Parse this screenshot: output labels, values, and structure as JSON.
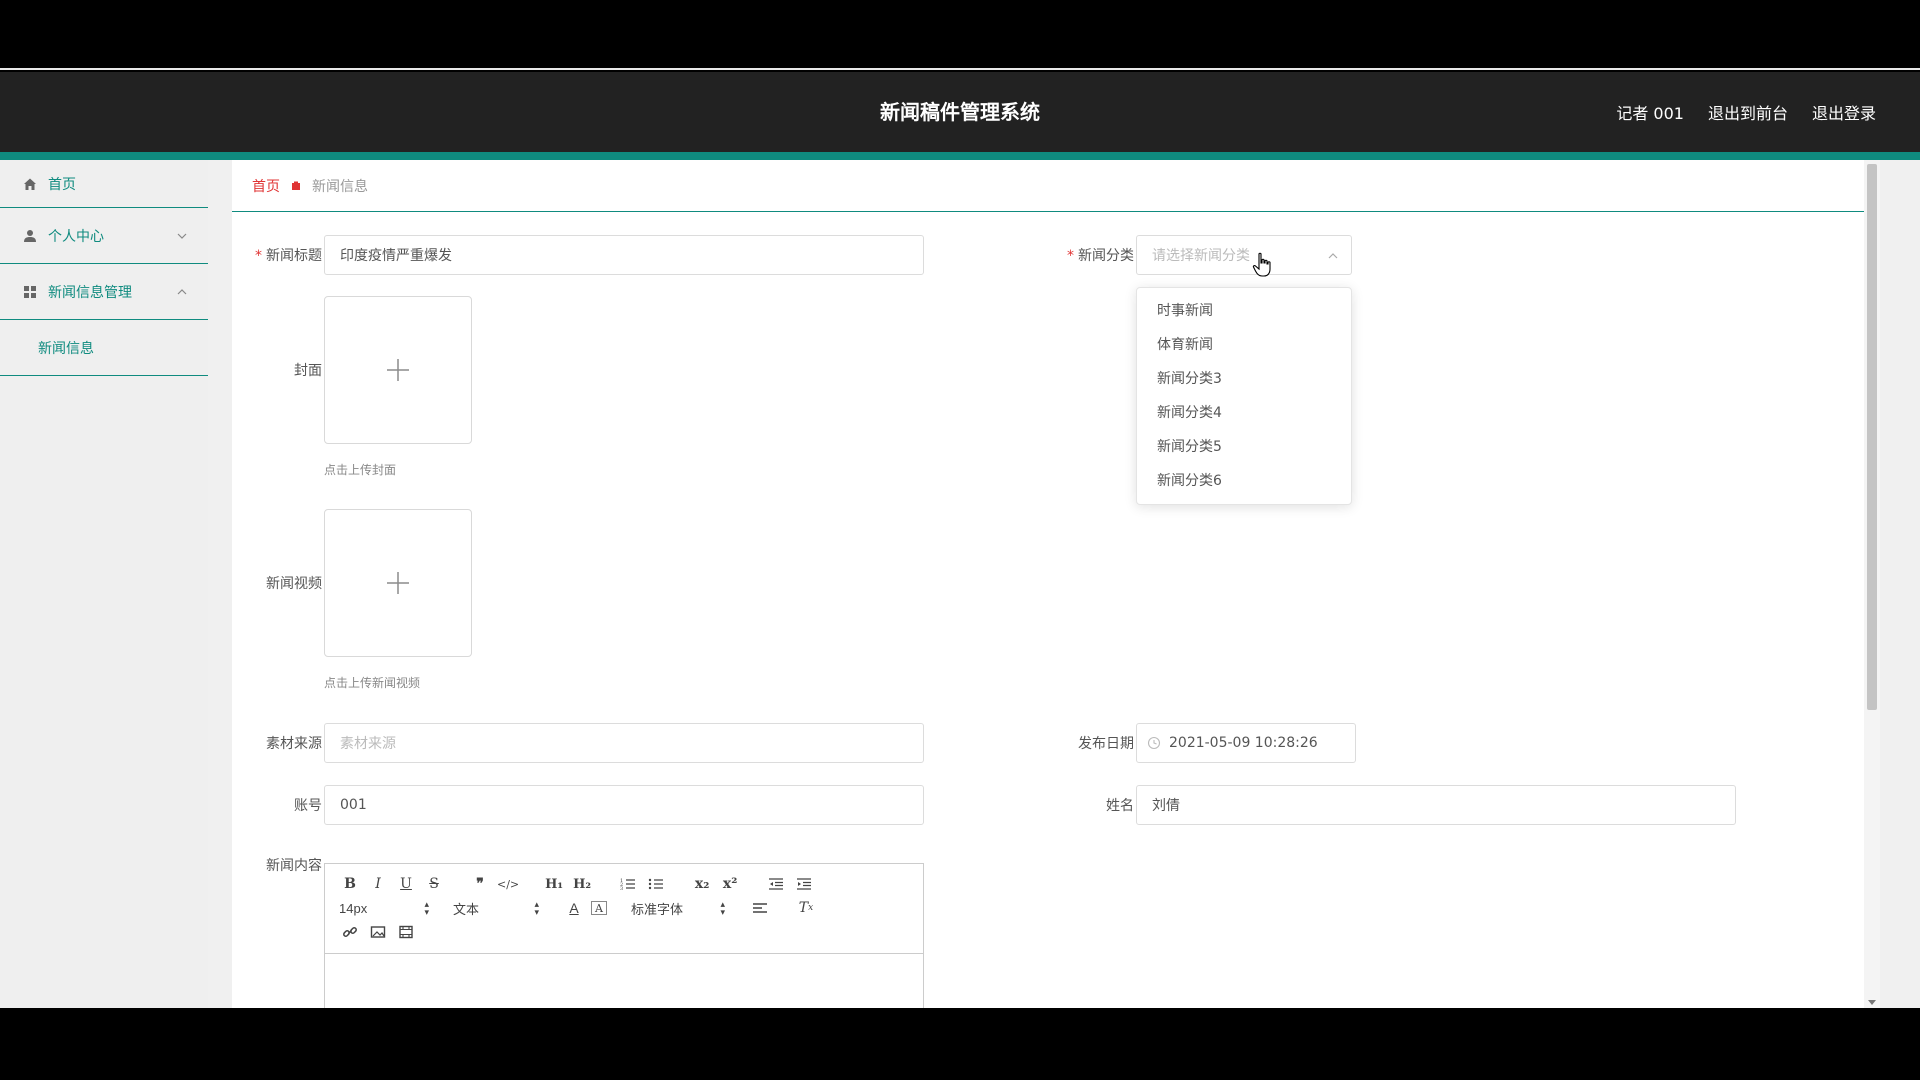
{
  "app": {
    "title": "新闻稿件管理系统",
    "user": "记者 001",
    "exit_front": "退出到前台",
    "logout": "退出登录",
    "accent_color": "#0f8b7f"
  },
  "sidebar": {
    "items": [
      {
        "label": "首页",
        "icon": "home-icon"
      },
      {
        "label": "个人中心",
        "icon": "user-icon",
        "expanded": false
      },
      {
        "label": "新闻信息管理",
        "icon": "grid-icon",
        "expanded": true
      }
    ],
    "subitems": [
      {
        "label": "新闻信息"
      }
    ]
  },
  "breadcrumb": {
    "home": "首页",
    "current": "新闻信息"
  },
  "form": {
    "title_label": "新闻标题",
    "title_value": "印度疫情严重爆发",
    "category_label": "新闻分类",
    "category_placeholder": "请选择新闻分类",
    "category_options": [
      "时事新闻",
      "体育新闻",
      "新闻分类3",
      "新闻分类4",
      "新闻分类5",
      "新闻分类6"
    ],
    "cover_label": "封面",
    "cover_hint": "点击上传封面",
    "video_label": "新闻视频",
    "video_hint": "点击上传新闻视频",
    "source_label": "素材来源",
    "source_placeholder": "素材来源",
    "date_label": "发布日期",
    "date_value": "2021-05-09 10:28:26",
    "account_label": "账号",
    "account_value": "001",
    "name_label": "姓名",
    "name_value": "刘倩",
    "content_label": "新闻内容"
  },
  "editor": {
    "font_size": "14px",
    "paragraph": "文本",
    "font_family": "标准字体"
  }
}
